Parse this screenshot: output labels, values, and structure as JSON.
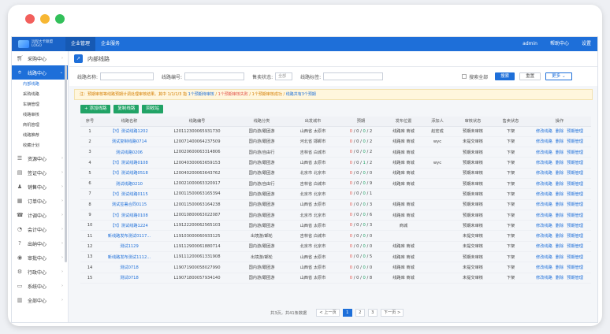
{
  "window": {
    "dot_colors": [
      "#f25f5c",
      "#f7b733",
      "#32c05a"
    ]
  },
  "header": {
    "logo_text": "远程大卡联盟\nLOGO",
    "nav": [
      "企业管理",
      "企业服务"
    ],
    "right": [
      "admin",
      "帮助中心",
      "设置"
    ]
  },
  "sidebar": {
    "items": [
      {
        "label": "采购中心",
        "icon": "cart-icon"
      },
      {
        "label": "线路中心",
        "icon": "location-icon",
        "active": true
      }
    ],
    "sub": [
      "内部线路",
      "采购线路",
      "车辆管理",
      "线路审核",
      "商机管理",
      "线路推荐",
      "收藏计划"
    ],
    "more": [
      {
        "label": "资源中心",
        "icon": "list-icon"
      },
      {
        "label": "签证中心",
        "icon": "doc-icon"
      },
      {
        "label": "销售中心",
        "icon": "user-icon"
      },
      {
        "label": "订单中心",
        "icon": "order-icon"
      },
      {
        "label": "计调中心",
        "icon": "phone-icon"
      },
      {
        "label": "会计中心",
        "icon": "account-icon"
      },
      {
        "label": "出纳中心",
        "icon": "question-icon"
      },
      {
        "label": "审批中心",
        "icon": "check-icon"
      },
      {
        "label": "行政中心",
        "icon": "gear-icon"
      },
      {
        "label": "系统中心",
        "icon": "system-icon"
      },
      {
        "label": "全部中心",
        "icon": "grid-icon"
      }
    ]
  },
  "page": {
    "title": "内部线路"
  },
  "filters": {
    "name_label": "线路名称:",
    "code_label": "线路编号:",
    "status_label": "售卖状态:",
    "status_value": "全部",
    "tag_label": "线路标签:",
    "search_all": "搜索全部",
    "search": "搜索",
    "reset": "重置",
    "more": "更多"
  },
  "notice": {
    "p1": "注：预期审核等线路预期计调处理审核结果。其中 1/1/1/3 指 ",
    "p2": "1个预期待审核",
    "p3": " / ",
    "p4": "1个预期审核失败",
    "p5": " / 1个预期审核成功 / ",
    "p6": "线路共有3个预期"
  },
  "actions": [
    "+ 添加线路",
    "复制线路",
    "回收站"
  ],
  "table": {
    "headers": [
      "序号",
      "线路名称",
      "线路编号",
      "线路分类",
      "出发城市",
      "预期",
      "发布位置",
      "添加人",
      "审核状态",
      "售卖状态",
      "操作"
    ],
    "ops": [
      "修改线路",
      "删除",
      "预期管理"
    ],
    "rows": [
      [
        "1",
        "【Y】测试线路1202",
        "L20112300065931730",
        "国内游/跟团游",
        "山西省 太原市",
        "0 / 0 / 0 / 2",
        "线路库 商城",
        "赵宏成",
        "预期未审核",
        "下架"
      ],
      [
        "2",
        "测试复制线路0714",
        "L20071400064237509",
        "国内游/跟团游",
        "河北省 邯郸市",
        "0 / 0 / 0 / 2",
        "线路库 商城",
        "wyc",
        "未提交审核",
        "下架"
      ],
      [
        "3",
        "测试线路0206",
        "L20020600063314806",
        "国内游/自由行",
        "吉林省 白城市",
        "0 / 0 / 0 / 2",
        "线路库 商城",
        "",
        "预期未审核",
        "下架"
      ],
      [
        "4",
        "【Y】测试线路0108",
        "L20040300063659153",
        "国内游/跟团游",
        "山西省 太原市",
        "0 / 0 / 1 / 2",
        "线路库 商城",
        "wyc",
        "预期未审核",
        "下架"
      ],
      [
        "5",
        "【Y】测试线路0518",
        "L20040200063643762",
        "国内游/跟团游",
        "北京市 北京市",
        "0 / 0 / 0 / 0",
        "线路库 商城",
        "",
        "预期未审核",
        "下架"
      ],
      [
        "6",
        "测试线路0210",
        "L20021000063320917",
        "国内游/自由行",
        "吉林省 白城市",
        "0 / 0 / 0 / 9",
        "线路库 商城",
        "",
        "预期未审核",
        "下架"
      ],
      [
        "7",
        "【Y】测试线路0115",
        "L20011500063165394",
        "国内游/跟团游",
        "北京市 北京市",
        "0 / 0 / 0 / 1",
        "",
        "",
        "预期未审核",
        "下架"
      ],
      [
        "8",
        "测试签署合同0115",
        "L20011500063164238",
        "国内游/跟团游",
        "山西省 太原市",
        "0 / 0 / 0 / 3",
        "线路库 商城",
        "",
        "预期未审核",
        "下架"
      ],
      [
        "9",
        "【Y】测试线路0108",
        "L20010800063022087",
        "国内游/跟团游",
        "北京市 北京市",
        "0 / 0 / 0 / 6",
        "线路库 商城",
        "",
        "预期未审核",
        "下架"
      ],
      [
        "10",
        "【Y】测试线路1224",
        "L19122200062565103",
        "国内游/跟团游",
        "山西省 太原市",
        "0 / 0 / 0 / 3",
        "商城",
        "",
        "预期未审核",
        "下架"
      ],
      [
        "11",
        "新线路发布测试0117...",
        "L19103000060933125",
        "出境游/邮轮",
        "吉林省 白城市",
        "0 / 0 / 0 / 0",
        "",
        "",
        "未提交审核",
        "下架"
      ],
      [
        "12",
        "测试1129",
        "L19112900061880714",
        "国内游/跟团游",
        "北京市 北京市",
        "0 / 0 / 0 / 0",
        "线路库 商城",
        "",
        "未提交审核",
        "下架"
      ],
      [
        "13",
        "新线路发布测试1112...",
        "L19111200061331908",
        "出境游/邮轮",
        "山西省 太原市",
        "0 / 0 / 0 / 5",
        "线路库 商城",
        "",
        "预期未审核",
        "下架"
      ],
      [
        "14",
        "测试0718",
        "L19071900058027990",
        "国内游/跟团游",
        "山西省 太原市",
        "0 / 0 / 0 / 0",
        "线路库 商城",
        "",
        "未提交审核",
        "下架"
      ],
      [
        "15",
        "测试0718",
        "L19071800057934140",
        "国内游/跟团游",
        "山西省 太原市",
        "0 / 0 / 0 / 8",
        "线路库 商城",
        "",
        "未提交审核",
        "下架"
      ]
    ]
  },
  "pager": {
    "summary": "共3页，共41条数据",
    "prev": "< 上一页",
    "pages": [
      "1",
      "2",
      "3"
    ],
    "next": "下一页 >"
  }
}
